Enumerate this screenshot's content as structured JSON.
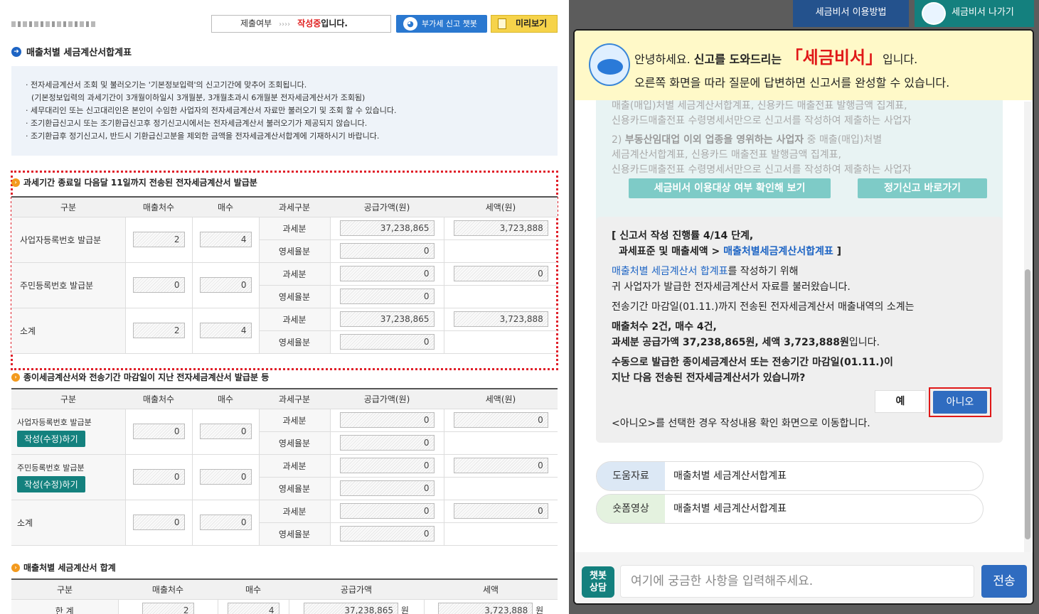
{
  "header": {
    "status_label": "제출여부",
    "status_arrow": "››››",
    "status_value": "작성중",
    "status_suffix": "입니다.",
    "chatbot_button": "부가세 신고 챗봇",
    "preview_button": "미리보기"
  },
  "section_title": "매출처별 세금계산서합계표",
  "notice": [
    "· 전자세금계산서 조회 및 불러오기는 '기본정보입력'의 신고기간에 맞추어 조회됩니다.",
    "  (기본정보입력의 과세기간이 3개월이하일시 3개월분, 3개월초과시 6개월분 전자세금계산서가 조회됨)",
    "· 세무대리인 또는 신고대리인은 본인이 수임한 사업자의 전자세금계산서 자료만 불러오기 및 조회 할 수 있습니다.",
    "· 조기환급신고시 또는 조기환급신고후 정기신고시에서는 전자세금계산서 불러오기가 제공되지 않습니다.",
    "· 조기환급후 정기신고시, 반드시 기환급신고분을 제외한 금액을 전자세금계산서합계에 기재하시기 바랍니다."
  ],
  "table1": {
    "title": "과세기간 종료일 다음달 11일까지 전송된 전자세금계산서 발급분",
    "headers": [
      "구분",
      "매출처수",
      "매수",
      "과세구분",
      "공급가액(원)",
      "세액(원)"
    ],
    "rows": [
      {
        "label": "사업자등록번호 발급분",
        "count": "2",
        "sheets": "4",
        "taxed": "과세분",
        "taxed_amount": "37,238,865",
        "taxed_tax": "3,723,888",
        "zero": "영세율분",
        "zero_amount": "0"
      },
      {
        "label": "주민등록번호 발급분",
        "count": "0",
        "sheets": "0",
        "taxed": "과세분",
        "taxed_amount": "0",
        "taxed_tax": "0",
        "zero": "영세율분",
        "zero_amount": "0"
      },
      {
        "label": "소계",
        "count": "2",
        "sheets": "4",
        "taxed": "과세분",
        "taxed_amount": "37,238,865",
        "taxed_tax": "3,723,888",
        "zero": "영세율분",
        "zero_amount": "0"
      }
    ]
  },
  "table2": {
    "title": "종이세금계산서와 전송기간 마감일이 지난 전자세금계산서 발급분 등",
    "headers": [
      "구분",
      "매출처수",
      "매수",
      "과세구분",
      "공급가액(원)",
      "세액(원)"
    ],
    "edit_label": "작성(수정)하기",
    "rows": [
      {
        "label": "사업자등록번호 발급분",
        "count": "0",
        "sheets": "0",
        "taxed": "과세분",
        "taxed_amount": "0",
        "taxed_tax": "0",
        "zero": "영세율분",
        "zero_amount": "0"
      },
      {
        "label": "주민등록번호 발급분",
        "count": "0",
        "sheets": "0",
        "taxed": "과세분",
        "taxed_amount": "0",
        "taxed_tax": "0",
        "zero": "영세율분",
        "zero_amount": "0"
      },
      {
        "label": "소계",
        "count": "0",
        "sheets": "0",
        "taxed": "과세분",
        "taxed_amount": "0",
        "taxed_tax": "0",
        "zero": "영세율분",
        "zero_amount": "0"
      }
    ]
  },
  "table3": {
    "title": "매출처별 세금계산서 합계",
    "headers": [
      "구분",
      "매출처수",
      "매수",
      "공급가액",
      "세액"
    ],
    "row": {
      "label": "한 계",
      "count": "2",
      "sheets": "4",
      "amount": "37,238,865",
      "amount_unit": "원",
      "tax": "3,723,888",
      "tax_unit": "원"
    }
  },
  "top_tabs": {
    "guide": "세금비서 이용방법",
    "exit": "세금비서 나가기"
  },
  "greeting": {
    "pre": "안녕하세요. ",
    "bold": "신고를 도와드리는 ",
    "brand": "「세금비서」",
    "post": "입니다.",
    "line2": "오른쪽 화면을 따라 질문에 답변하면 신고서를 완성할 수 있습니다."
  },
  "prev_card": {
    "line1": "매출(매입)처별 세금계산서합계표, 신용카드 매출전표 발행금액 집계표,",
    "line2": "신용카드매출전표 수령명세서만으로 신고서를 작성하여 제출하는 사업자",
    "line3_a": "2) ",
    "line3_b": "부동산임대업 이외 업종을 영위하는 사업자",
    "line3_c": " 중 매출(매입)처별",
    "line4": "세금계산서합계표, 신용카드 매출전표 발행금액 집계표,",
    "line5": "신용카드매출전표 수령명세서만으로 신고서를 작성하여 제출하는 사업자",
    "btn_check": "세금비서 이용대상 여부 확인해 보기",
    "btn_regular": "정기신고 바로가기"
  },
  "message": {
    "progress_a": "[ 신고서 작성 진행률 4/14 단계,",
    "progress_b1": "과세표준 및 매출세액 > ",
    "progress_b2": "매출처별세금계산서합계표",
    "progress_b3": " ]",
    "p1_blue": "매출처별 세금계산서 합계표",
    "p1_rest": "를 작성하기 위해",
    "p2": "귀 사업자가 발급한 전자세금계산서 자료를 불러왔습니다.",
    "p3": "전송기간 마감일(01.11.)까지 전송된 전자세금계산서 매출내역의 소계는",
    "p4": "매출처수 2건, 매수 4건,",
    "p5": "과세분 공급가액 37,238,865원, 세액 3,723,888원",
    "p5_end": "입니다.",
    "q1": "수동으로 발급한 종이세금계산서 또는 전송기간 마감일(01.11.)이",
    "q2": "지난 다음 전송된 전자세금계산서가 있습니까?",
    "yes": "예",
    "no": "아니오",
    "note": "<아니오>를 선택한 경우 작성내용 확인 화면으로 이동합니다."
  },
  "links": [
    {
      "tag": "도움자료",
      "text": "매출처별 세금계산서합계표",
      "color": "#dce8f5"
    },
    {
      "tag": "숏폼영상",
      "text": "매출처별 세금계산서합계표",
      "color": "#e4f2df"
    }
  ],
  "input": {
    "badge_top": "챗봇",
    "badge_bottom": "상담",
    "placeholder": "여기에 궁금한 사항을 입력해주세요.",
    "send": "전송"
  }
}
